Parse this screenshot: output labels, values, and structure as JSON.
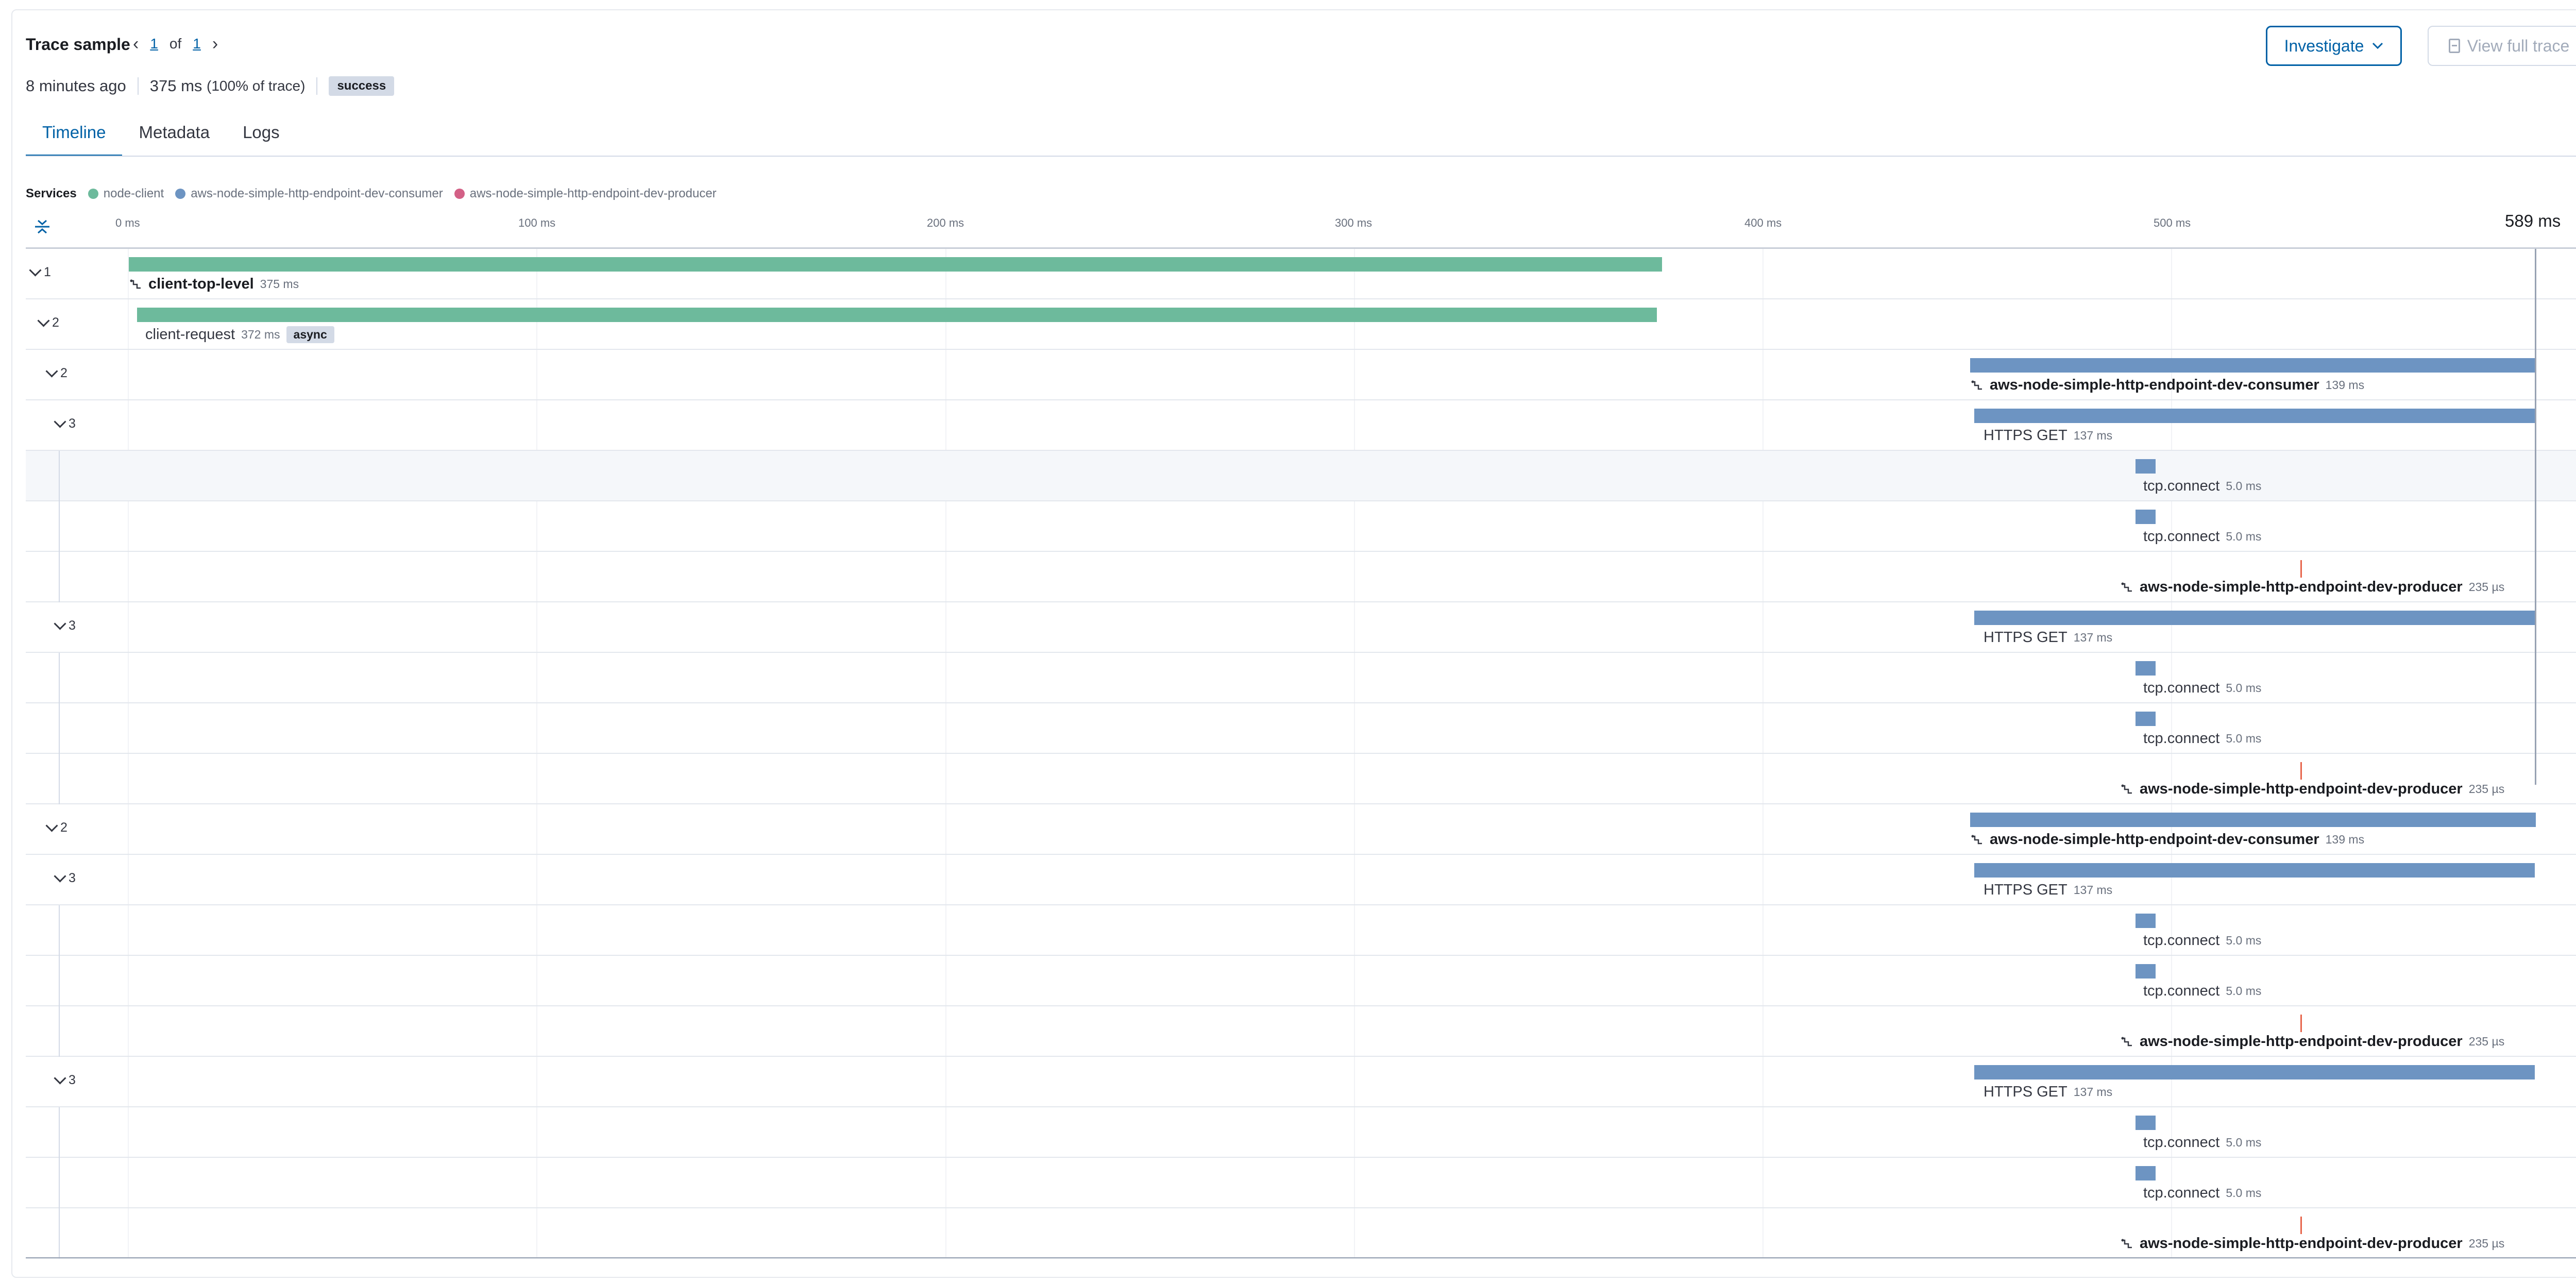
{
  "header": {
    "title": "Trace sample",
    "pager": {
      "current": "1",
      "of": "of",
      "total": "1"
    },
    "time_ago": "8 minutes ago",
    "duration": "375 ms",
    "duration_pct": "(100% of trace)",
    "status": "success",
    "investigate_label": "Investigate",
    "view_full_trace_label": "View full trace"
  },
  "tabs": [
    {
      "label": "Timeline",
      "active": true
    },
    {
      "label": "Metadata",
      "active": false
    },
    {
      "label": "Logs",
      "active": false
    }
  ],
  "services": {
    "label": "Services",
    "items": [
      {
        "name": "node-client",
        "color": "#6dba9c"
      },
      {
        "name": "aws-node-simple-http-endpoint-dev-consumer",
        "color": "#6d94c2"
      },
      {
        "name": "aws-node-simple-http-endpoint-dev-producer",
        "color": "#d36086"
      }
    ]
  },
  "axis": {
    "ticks": [
      "0 ms",
      "100 ms",
      "200 ms",
      "300 ms",
      "400 ms",
      "500 ms"
    ],
    "max": "589 ms"
  },
  "rows": [
    {
      "toggle": "1",
      "name": "client-top-level",
      "dur": "375 ms",
      "bold": true,
      "icon": true,
      "badge": ""
    },
    {
      "toggle": "2",
      "name": "client-request",
      "dur": "372 ms",
      "bold": false,
      "icon": false,
      "badge": "async"
    },
    {
      "toggle": "2",
      "name": "aws-node-simple-http-endpoint-dev-consumer",
      "dur": "139 ms",
      "bold": true,
      "icon": true,
      "badge": ""
    },
    {
      "toggle": "3",
      "name": "HTTPS GET",
      "dur": "137 ms",
      "bold": false,
      "icon": false,
      "badge": ""
    },
    {
      "toggle": "",
      "name": "tcp.connect",
      "dur": "5.0 ms",
      "bold": false,
      "icon": false,
      "badge": ""
    },
    {
      "toggle": "",
      "name": "tcp.connect",
      "dur": "5.0 ms",
      "bold": false,
      "icon": false,
      "badge": ""
    },
    {
      "toggle": "",
      "name": "aws-node-simple-http-endpoint-dev-producer",
      "dur": "235 µs",
      "bold": true,
      "icon": true,
      "badge": ""
    },
    {
      "toggle": "3",
      "name": "HTTPS GET",
      "dur": "137 ms",
      "bold": false,
      "icon": false,
      "badge": ""
    },
    {
      "toggle": "",
      "name": "tcp.connect",
      "dur": "5.0 ms",
      "bold": false,
      "icon": false,
      "badge": ""
    },
    {
      "toggle": "",
      "name": "tcp.connect",
      "dur": "5.0 ms",
      "bold": false,
      "icon": false,
      "badge": ""
    },
    {
      "toggle": "",
      "name": "aws-node-simple-http-endpoint-dev-producer",
      "dur": "235 µs",
      "bold": true,
      "icon": true,
      "badge": ""
    },
    {
      "toggle": "2",
      "name": "aws-node-simple-http-endpoint-dev-consumer",
      "dur": "139 ms",
      "bold": true,
      "icon": true,
      "badge": ""
    },
    {
      "toggle": "3",
      "name": "HTTPS GET",
      "dur": "137 ms",
      "bold": false,
      "icon": false,
      "badge": ""
    },
    {
      "toggle": "",
      "name": "tcp.connect",
      "dur": "5.0 ms",
      "bold": false,
      "icon": false,
      "badge": ""
    },
    {
      "toggle": "",
      "name": "tcp.connect",
      "dur": "5.0 ms",
      "bold": false,
      "icon": false,
      "badge": ""
    },
    {
      "toggle": "",
      "name": "aws-node-simple-http-endpoint-dev-producer",
      "dur": "235 µs",
      "bold": true,
      "icon": true,
      "badge": ""
    },
    {
      "toggle": "3",
      "name": "HTTPS GET",
      "dur": "137 ms",
      "bold": false,
      "icon": false,
      "badge": ""
    },
    {
      "toggle": "",
      "name": "tcp.connect",
      "dur": "5.0 ms",
      "bold": false,
      "icon": false,
      "badge": ""
    },
    {
      "toggle": "",
      "name": "tcp.connect",
      "dur": "5.0 ms",
      "bold": false,
      "icon": false,
      "badge": ""
    },
    {
      "toggle": "",
      "name": "aws-node-simple-http-endpoint-dev-producer",
      "dur": "235 µs",
      "bold": true,
      "icon": true,
      "badge": ""
    }
  ]
}
